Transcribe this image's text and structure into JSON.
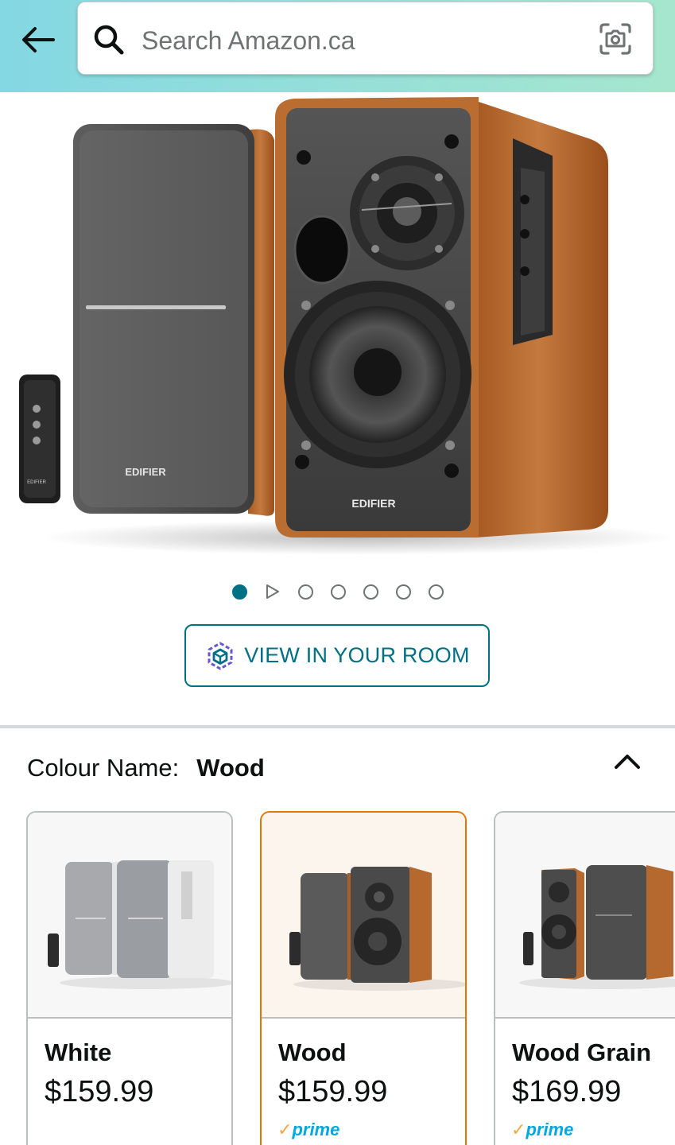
{
  "search": {
    "placeholder": "Search Amazon.ca"
  },
  "product": {
    "brand_label": "EDIFIER",
    "remote_brand_label": "EDIFIER"
  },
  "carousel": {
    "count": 7,
    "active_index": 0
  },
  "view_in_room": {
    "label": "VIEW IN YOUR ROOM"
  },
  "colour": {
    "label": "Colour Name:",
    "selected": "Wood",
    "options": [
      {
        "name": "White",
        "price": "$159.99",
        "prime": false
      },
      {
        "name": "Wood",
        "price": "$159.99",
        "prime": true,
        "prime_label": "prime"
      },
      {
        "name": "Wood Grain",
        "price": "$169.99",
        "prime": true,
        "prime_label": "prime"
      }
    ]
  },
  "colors": {
    "header_start": "#84d8e3",
    "header_end": "#a6e6ce",
    "teal": "#007185",
    "selected_border": "#e77600",
    "wood": "#b5692e",
    "prime_blue": "#00a8e1",
    "prime_check": "#f3a847"
  }
}
